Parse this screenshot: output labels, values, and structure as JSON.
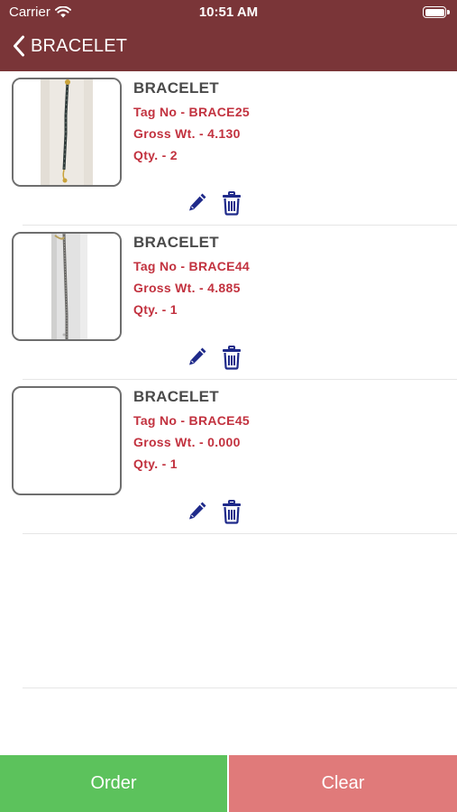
{
  "status_bar": {
    "carrier": "Carrier",
    "time": "10:51 AM"
  },
  "header": {
    "title": "BRACELET"
  },
  "items": [
    {
      "name": "BRACELET",
      "tag": "Tag No - BRACE25",
      "gross": "Gross Wt. - 4.130",
      "qty": "Qty. - 2"
    },
    {
      "name": "BRACELET",
      "tag": "Tag No - BRACE44",
      "gross": "Gross Wt. - 4.885",
      "qty": "Qty. - 1"
    },
    {
      "name": "BRACELET",
      "tag": "Tag No - BRACE45",
      "gross": "Gross Wt. - 0.000",
      "qty": "Qty. - 1"
    }
  ],
  "footer": {
    "order_label": "Order",
    "clear_label": "Clear"
  },
  "colors": {
    "header": "#7a3538",
    "detail_text": "#c2323f",
    "icon": "#1f2a8a",
    "order": "#5cc25c",
    "clear": "#e07a7a"
  }
}
